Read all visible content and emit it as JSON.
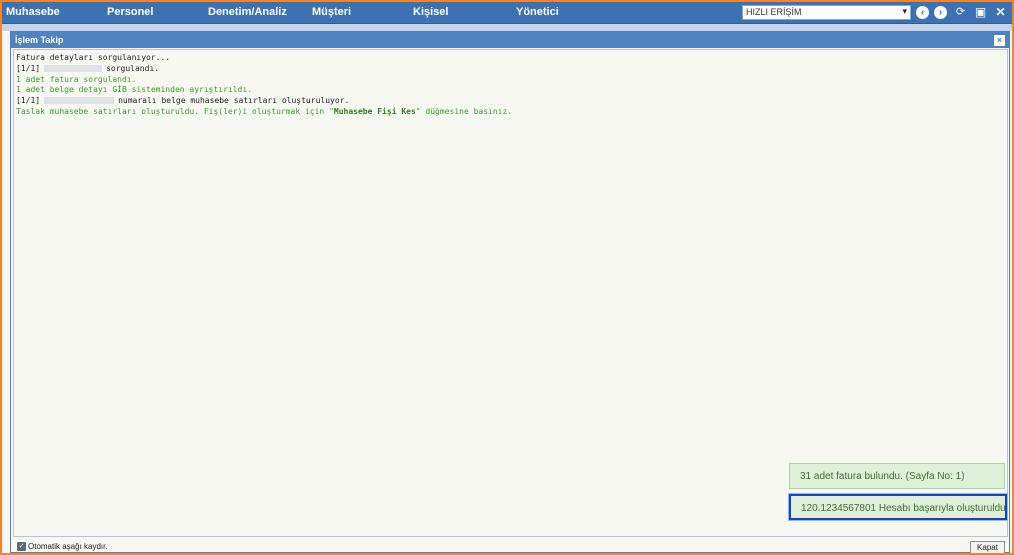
{
  "menubar": {
    "items": [
      "Muhasebe",
      "Personel",
      "Denetim/Analiz",
      "Müşteri",
      "Kişisel",
      "Yönetici"
    ],
    "quick_access": "HIZLI ERİŞİM",
    "accent_color": "#3c72b4"
  },
  "modal": {
    "title": "İşlem Takip",
    "close_glyph": "×",
    "log": [
      {
        "parts": [
          "Fatura detayları sorgulanıyor..."
        ],
        "color": "black"
      },
      {
        "parts": [
          "[1/1]",
          "REDACT",
          "sorgulandı."
        ],
        "color": "black"
      },
      {
        "parts": [
          "1 adet fatura sorgulandı."
        ],
        "color": "green"
      },
      {
        "parts": [
          "1 adet belge detayı GİB sisteminden ayrıştırıldı."
        ],
        "color": "green"
      },
      {
        "parts": [
          "[1/1]",
          "REDACT",
          "numaralı belge muhasebe satırları oluşturuluyor."
        ],
        "color": "black"
      },
      {
        "parts": [
          "Taslak muhasebe satırları oluşturuldu. Fiş(ler)i oluşturmak için \"",
          "Muhasebe Fişi Kes",
          "\" düğmesine basınız."
        ],
        "color": "green"
      }
    ],
    "auto_scroll_label": "Otomatik aşağı kaydır.",
    "close_button": "Kapat"
  },
  "toasts": [
    "31 adet fatura bulundu. (Sayfa No: 1)",
    "120.1234567801 Hesabı başarıyla oluşturuldu."
  ]
}
